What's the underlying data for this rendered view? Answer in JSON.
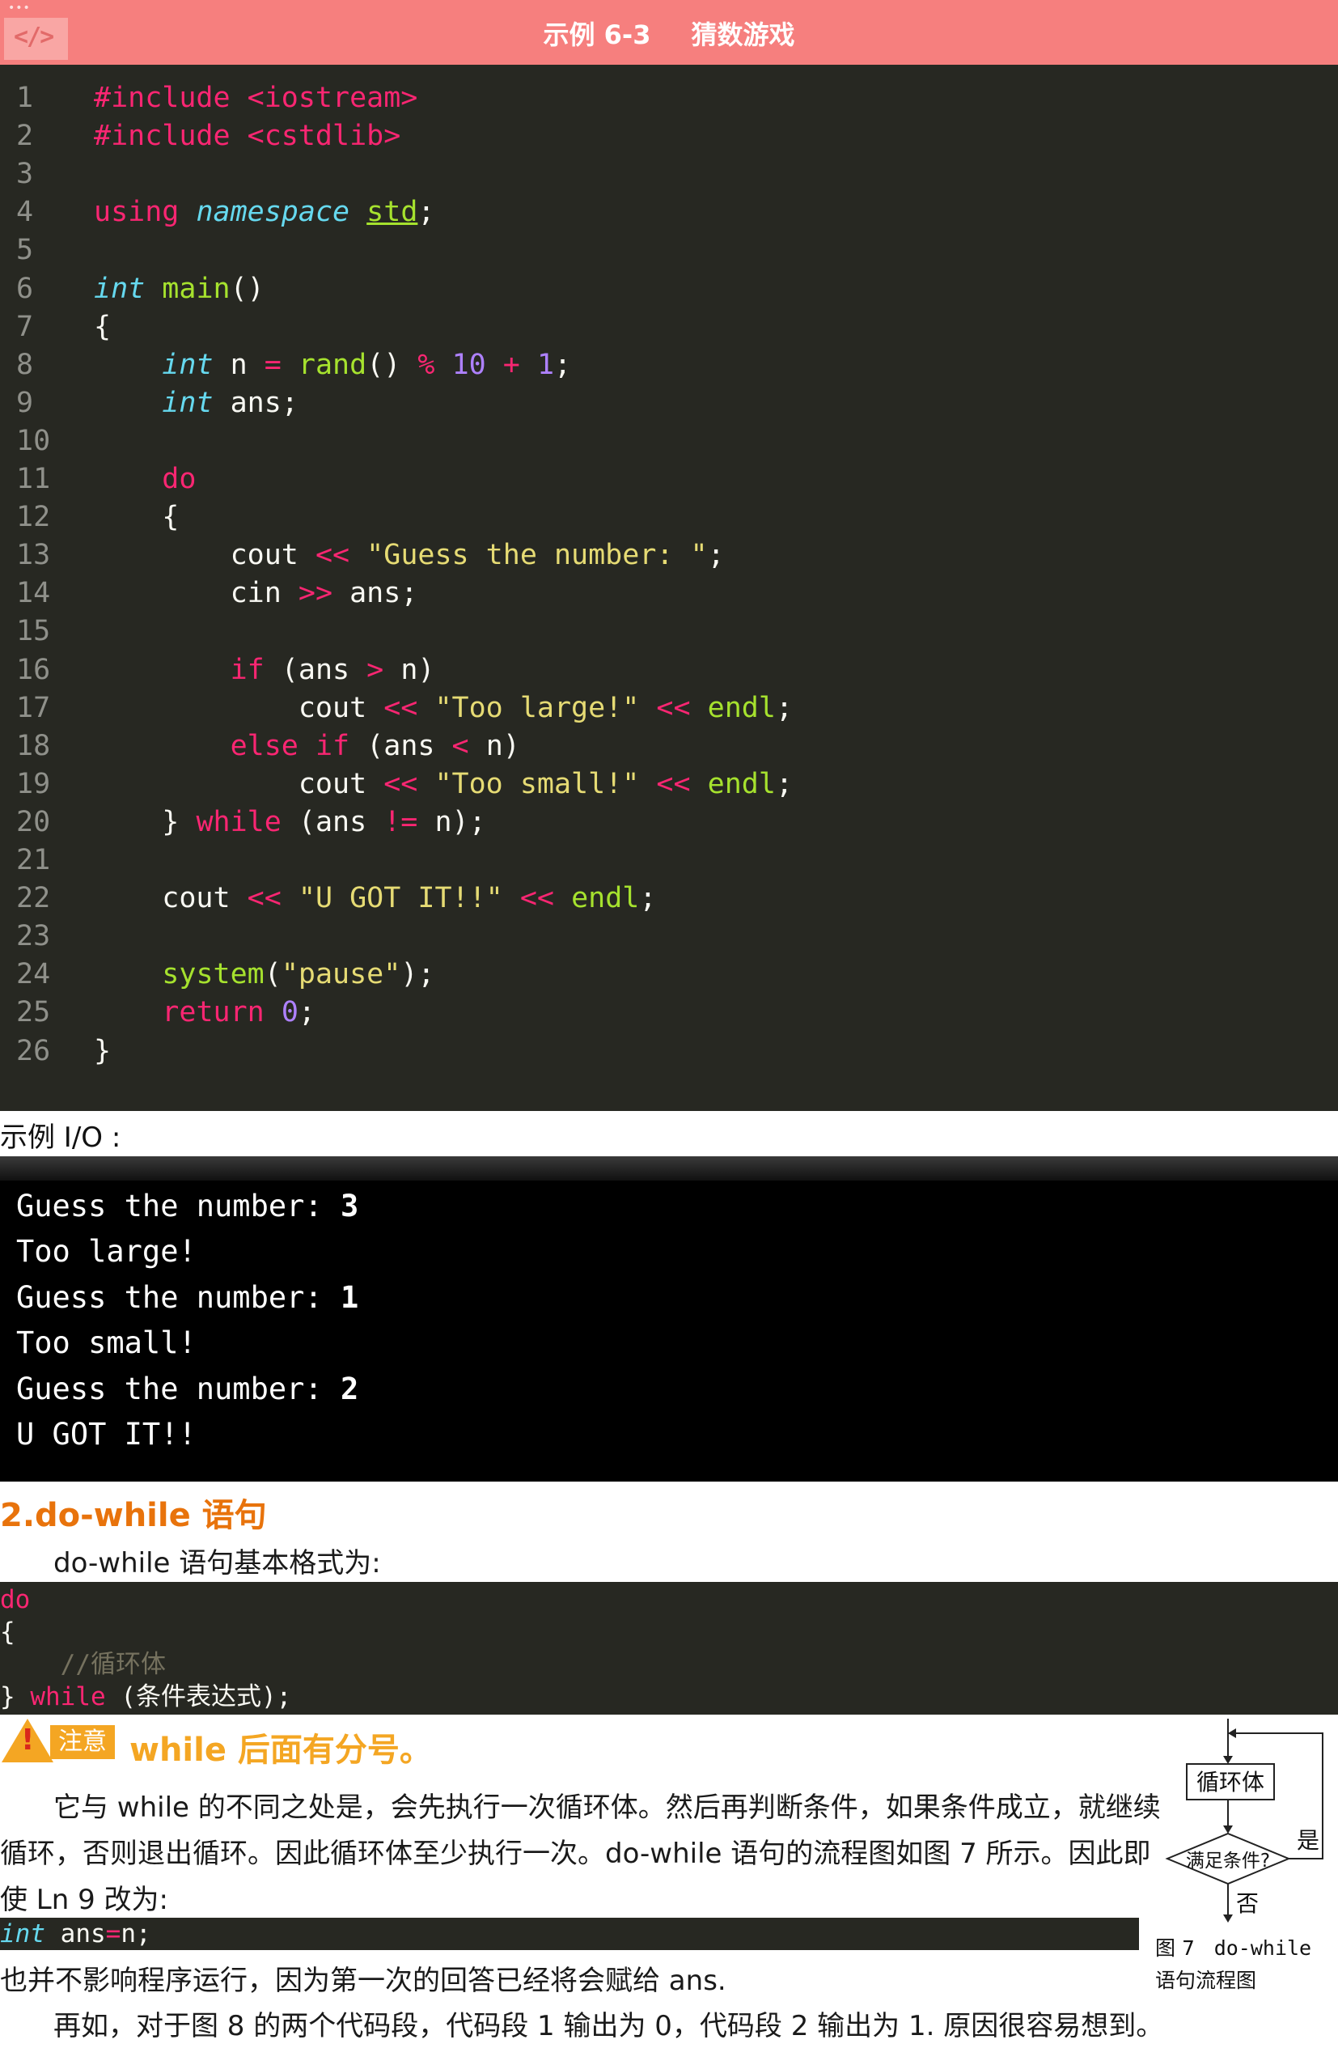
{
  "header": {
    "dots": "•••",
    "icon": "code-icon",
    "example_no": "示例 6-3",
    "example_title": "猜数游戏"
  },
  "code": {
    "line_numbers": [
      "1",
      "2",
      "3",
      "4",
      "5",
      "6",
      "7",
      "8",
      "9",
      "10",
      "11",
      "12",
      "13",
      "14",
      "15",
      "16",
      "17",
      "18",
      "19",
      "20",
      "21",
      "22",
      "23",
      "24",
      "25",
      "26"
    ],
    "lines": [
      "#include <iostream>",
      "#include <cstdlib>",
      "",
      "using namespace std;",
      "",
      "int main()",
      "{",
      "    int n = rand() % 10 + 1;",
      "    int ans;",
      "",
      "    do",
      "    {",
      "        cout << \"Guess the number: \";",
      "        cin >> ans;",
      "",
      "        if (ans > n)",
      "            cout << \"Too large!\" << endl;",
      "        else if (ans < n)",
      "            cout << \"Too small!\" << endl;",
      "    } while (ans != n);",
      "",
      "    cout << \"U GOT IT!!\" << endl;",
      "",
      "    system(\"pause\");",
      "    return 0;",
      "}"
    ]
  },
  "io": {
    "label": "示例 I/O :",
    "lines": [
      {
        "text": "Guess the number: ",
        "input": "3"
      },
      {
        "text": "Too large!",
        "input": ""
      },
      {
        "text": "Guess the number: ",
        "input": "1"
      },
      {
        "text": "Too small!",
        "input": ""
      },
      {
        "text": "Guess the number: ",
        "input": "2"
      },
      {
        "text": "U GOT IT!!",
        "input": ""
      }
    ]
  },
  "section": {
    "title": "2.do-while 语句",
    "intro": "do-while 语句基本格式为:",
    "syntax": [
      "do",
      "{",
      "    //循环体",
      "} while (条件表达式);"
    ],
    "note_tag": "注意",
    "note_text": "while 后面有分号。",
    "para1": [
      "它与 while 的不同之处是，会先执行一次循环体。然后再判断条件，如果条件成立，就继续",
      "循环，否则退出循环。因此循环体至少执行一次。do-while 语句的流程图如图 7 所示。因此即",
      "使 Ln 9 改为:"
    ],
    "snippet2": "int ans=n;",
    "para2": "也并不影响程序运行，因为第一次的回答已经将会赋给 ans.",
    "para3": "再如，对于图 8 的两个代码段，代码段 1 输出为 0，代码段 2 输出为 1. 原因很容易想到。"
  },
  "flowchart": {
    "body": "循环体",
    "cond": "满足条件?",
    "yes": "是",
    "no": "否",
    "caption_fig": "图 7",
    "caption_kw": "do-while",
    "caption_rest": "语句流程图"
  },
  "colors": {
    "header_bg": "#f67f7e",
    "editor_bg": "#272822",
    "keyword": "#f92672",
    "type": "#66d9ef",
    "function": "#a6e22e",
    "string": "#e6db74",
    "number": "#ae81ff",
    "section_title": "#e8730c",
    "note": "#f4a623"
  }
}
